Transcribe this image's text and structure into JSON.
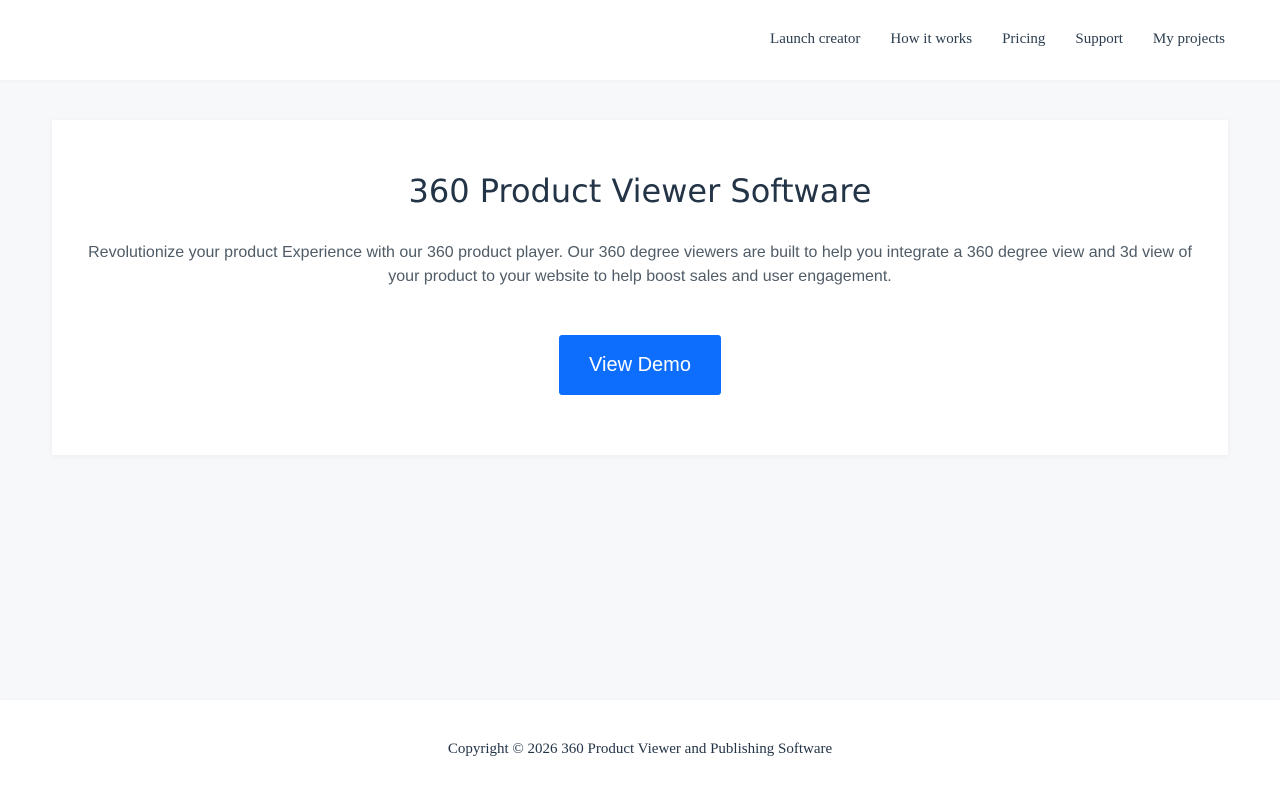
{
  "nav": {
    "items": [
      {
        "label": "Launch creator"
      },
      {
        "label": "How it works"
      },
      {
        "label": "Pricing"
      },
      {
        "label": "Support"
      },
      {
        "label": "My projects"
      }
    ]
  },
  "hero": {
    "title": "360 Product Viewer Software",
    "description": "Revolutionize your product Experience with our 360 product player. Our 360 degree viewers are built to help you integrate a 360 degree view and 3d view of your product to your website to help boost sales and user engagement.",
    "cta_label": "View Demo"
  },
  "footer": {
    "copyright": "Copyright © 2026 360 Product Viewer and Publishing Software"
  },
  "colors": {
    "accent": "#0d6efd",
    "background": "#f7f8fa",
    "heading": "#243447",
    "body_text": "#4f5b66"
  }
}
